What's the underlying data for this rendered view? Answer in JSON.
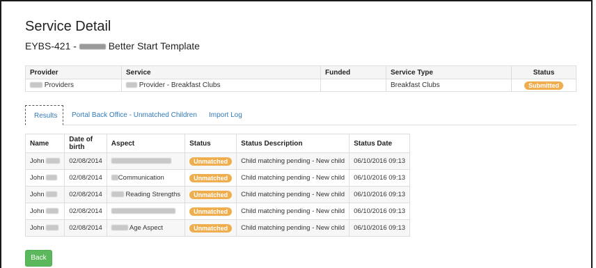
{
  "page": {
    "title": "Service Detail",
    "subtitle_prefix": "EYBS-421 - ",
    "subtitle_suffix": "Better Start Template"
  },
  "provider_table": {
    "headers": [
      "Provider",
      "Service",
      "Funded",
      "Service Type",
      "Status"
    ],
    "row": {
      "provider": "Providers",
      "service": "Provider - Breakfast Clubs",
      "funded": "",
      "service_type": "Breakfast Clubs",
      "status": "Submitted"
    }
  },
  "tabs": [
    {
      "label": "Results",
      "active": true
    },
    {
      "label": "Portal Back Office - Unmatched Children",
      "active": false
    },
    {
      "label": "Import Log",
      "active": false
    }
  ],
  "results_table": {
    "headers": [
      "Name",
      "Date of birth",
      "Aspect",
      "Status",
      "Status Description",
      "Status Date"
    ],
    "rows": [
      {
        "name": "John",
        "dob": "02/08/2014",
        "aspect": "",
        "status": "Unmatched",
        "description": "Child matching pending - New child",
        "date": "06/10/2016 09:13"
      },
      {
        "name": "John",
        "dob": "02/08/2014",
        "aspect": "Communication",
        "status": "Unmatched",
        "description": "Child matching pending - New child",
        "date": "06/10/2016 09:13"
      },
      {
        "name": "John",
        "dob": "02/08/2014",
        "aspect": "Reading Strengths",
        "status": "Unmatched",
        "description": "Child matching pending - New child",
        "date": "06/10/2016 09:13"
      },
      {
        "name": "John",
        "dob": "02/08/2014",
        "aspect": "",
        "status": "Unmatched",
        "description": "Child matching pending - New child",
        "date": "06/10/2016 09:13"
      },
      {
        "name": "John",
        "dob": "02/08/2014",
        "aspect": "Age Aspect",
        "status": "Unmatched",
        "description": "Child matching pending - New child",
        "date": "06/10/2016 09:13"
      }
    ]
  },
  "back_button": "Back",
  "colors": {
    "badge": "#f0ad4e",
    "link": "#337ab7",
    "back_button": "#5cb85c"
  }
}
